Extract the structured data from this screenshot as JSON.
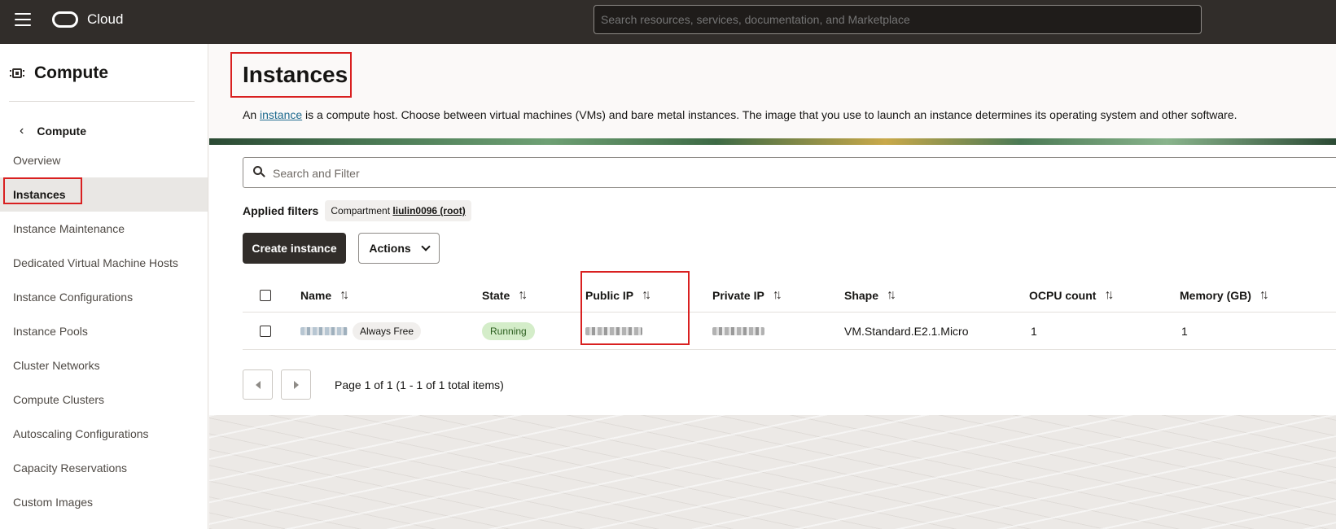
{
  "header": {
    "brand": "Cloud",
    "search_placeholder": "Search resources, services, documentation, and Marketplace"
  },
  "sidebar": {
    "title": "Compute",
    "back_label": "Compute",
    "items": [
      {
        "label": "Overview",
        "active": false
      },
      {
        "label": "Instances",
        "active": true
      },
      {
        "label": "Instance Maintenance",
        "active": false
      },
      {
        "label": "Dedicated Virtual Machine Hosts",
        "active": false
      },
      {
        "label": "Instance Configurations",
        "active": false
      },
      {
        "label": "Instance Pools",
        "active": false
      },
      {
        "label": "Cluster Networks",
        "active": false
      },
      {
        "label": "Compute Clusters",
        "active": false
      },
      {
        "label": "Autoscaling Configurations",
        "active": false
      },
      {
        "label": "Capacity Reservations",
        "active": false
      },
      {
        "label": "Custom Images",
        "active": false
      }
    ]
  },
  "main": {
    "title": "Instances",
    "description": {
      "prefix": "An ",
      "link": "instance",
      "suffix": " is a compute host. Choose between virtual machines (VMs) and bare metal instances. The image that you use to launch an instance determines its operating system and other software."
    },
    "filter_placeholder": "Search and Filter",
    "applied_filters_label": "Applied filters",
    "filter_chip": {
      "key": "Compartment",
      "value": "liulin0096 (root)"
    },
    "create_button": "Create instance",
    "actions_button": "Actions",
    "table": {
      "columns": [
        "Name",
        "State",
        "Public IP",
        "Private IP",
        "Shape",
        "OCPU count",
        "Memory (GB)"
      ],
      "rows": [
        {
          "name_tag": "Always Free",
          "state": "Running",
          "shape": "VM.Standard.E2.1.Micro",
          "ocpu": "1",
          "memory": "1"
        }
      ]
    },
    "pagination": "Page 1 of 1 (1 - 1 of 1 total items)"
  },
  "colors": {
    "topbar": "#312d2a",
    "highlight": "#d92020",
    "running_badge": "#d4edc9",
    "link": "#1f6b8f"
  }
}
